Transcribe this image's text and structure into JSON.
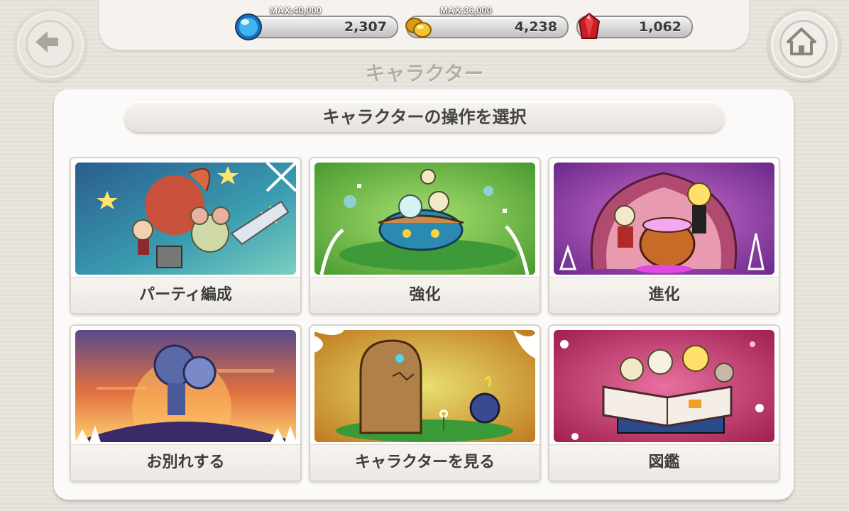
{
  "header": {
    "back_icon": "back-arrow-icon",
    "home_icon": "home-icon",
    "screen_title": "キャラクター"
  },
  "resources": [
    {
      "name": "blue-orb",
      "max_label": "MAX:40,000",
      "value": "2,307",
      "icon": "blue-orb-icon",
      "color": "#2aa0e8"
    },
    {
      "name": "gold",
      "max_label": "MAX:36,000",
      "value": "4,238",
      "icon": "gold-coins-icon",
      "color": "#f0b423"
    },
    {
      "name": "red-gem",
      "max_label": "",
      "value": "1,062",
      "icon": "red-gem-icon",
      "color": "#c81e28"
    }
  ],
  "panel": {
    "title": "キャラクターの操作を選択",
    "options": [
      {
        "label": "パーティ編成",
        "art_icon": "party-formation-art"
      },
      {
        "label": "強化",
        "art_icon": "enhance-art"
      },
      {
        "label": "進化",
        "art_icon": "evolve-art"
      },
      {
        "label": "お別れする",
        "art_icon": "farewell-art"
      },
      {
        "label": "キャラクターを見る",
        "art_icon": "view-characters-art"
      },
      {
        "label": "図鑑",
        "art_icon": "encyclopedia-art"
      }
    ]
  }
}
